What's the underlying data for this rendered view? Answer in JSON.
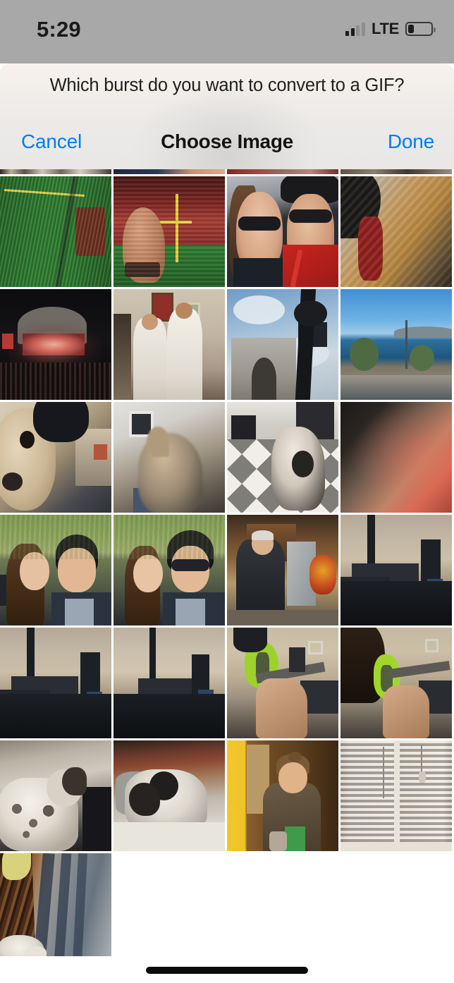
{
  "status_bar": {
    "time": "5:29",
    "carrier_network": "LTE",
    "signal_bars_filled": 2,
    "signal_bars_total": 4,
    "battery_percent": 26,
    "background_color": "#a8a8a8"
  },
  "dialog": {
    "prompt": "Which burst do you want to convert to a GIF?",
    "cancel_label": "Cancel",
    "title": "Choose Image",
    "done_label": "Done",
    "accent_color": "#007aff",
    "title_color": "#141414"
  },
  "photo_grid": {
    "columns": 4,
    "cell_size": 158,
    "gap": 3,
    "rows": [
      {
        "partial": true,
        "cells": [
          {
            "name": "thumb-sliver-text-banner",
            "art": "a-sl1",
            "alt": "cropped bottom edge of banner photo"
          },
          {
            "name": "thumb-sliver-dark-blue",
            "art": "a-sl2",
            "alt": "cropped bottom edge of dark photo"
          },
          {
            "name": "thumb-sliver-red-crowd",
            "art": "a-sl3",
            "alt": "cropped bottom edge of red crowd photo"
          },
          {
            "name": "thumb-sliver-tan",
            "art": "a-sl4",
            "alt": "cropped bottom edge of tan photo"
          }
        ]
      },
      {
        "partial": false,
        "cells": [
          {
            "name": "thumb-stadium-aerial",
            "art": "a-stad1",
            "alt": "aerial view of packed football stadium with green field"
          },
          {
            "name": "thumb-stadium-hand-field",
            "art": "a-stad2",
            "alt": "hand raised in front of football field goalpost"
          },
          {
            "name": "thumb-couple-selfie-game",
            "art": "a-couple-red",
            "alt": "couple selfie in sunglasses at game wearing red"
          },
          {
            "name": "thumb-golden-dog-car",
            "art": "a-dog-gold",
            "alt": "golden fluffy dog curled up"
          }
        ]
      },
      {
        "partial": false,
        "cells": [
          {
            "name": "thumb-concert-amphitheater",
            "art": "a-bowl",
            "alt": "lit concert stage at night amphitheater"
          },
          {
            "name": "thumb-two-men-white-shirts",
            "art": "a-twomen",
            "alt": "two men in white shirts standing indoors"
          },
          {
            "name": "thumb-arc-de-triomphe",
            "art": "a-arc",
            "alt": "Arc de Triomphe under cloudy blue sky with pole"
          },
          {
            "name": "thumb-seaside-road",
            "art": "a-sea",
            "alt": "coastal road with blue sea and trees"
          }
        ]
      },
      {
        "partial": false,
        "cells": [
          {
            "name": "thumb-dog-closeup-cap",
            "art": "a-dogcap",
            "alt": "close-up of tan dog face near a black cap"
          },
          {
            "name": "thumb-fluffy-dog-blur",
            "art": "a-fluffy",
            "alt": "blurry fluffy dog indoors"
          },
          {
            "name": "thumb-dog-on-quilt",
            "art": "a-quilt",
            "alt": "dog on grey and white checkered quilt"
          },
          {
            "name": "thumb-blurred-warm-motion",
            "art": "a-warmblur-w",
            "alt": "heavily blurred warm-toned motion shot"
          }
        ]
      },
      {
        "partial": false,
        "cells": [
          {
            "name": "thumb-couple-kiss-grass",
            "art": "a-kiss",
            "alt": "woman kissing man on cheek on grass"
          },
          {
            "name": "thumb-couple-glasses-grass",
            "art": "a-couple2",
            "alt": "couple posing together on grass, man in glasses"
          },
          {
            "name": "thumb-kitchen-older-man",
            "art": "a-kitchen",
            "alt": "older man in kitchen near fridge and fall flowers"
          },
          {
            "name": "thumb-shooting-range-bench-1",
            "art": "a-range1",
            "alt": "outdoor shooting range bench in shade"
          }
        ]
      },
      {
        "partial": false,
        "cells": [
          {
            "name": "thumb-shooting-range-bench-2",
            "art": "a-range1",
            "alt": "shooting range bench with person aiming"
          },
          {
            "name": "thumb-shooting-range-bench-3",
            "art": "a-range2",
            "alt": "shooting range bench second frame"
          },
          {
            "name": "thumb-shooter-green-earmuffs-1",
            "art": "a-shooter1",
            "alt": "shooter in green earmuffs aiming rifle downrange"
          },
          {
            "name": "thumb-shooter-green-earmuffs-2",
            "art": "a-shooter2",
            "alt": "shooter with dark hair in green earmuffs aiming rifle"
          }
        ]
      },
      {
        "partial": false,
        "cells": [
          {
            "name": "thumb-spotted-dog-room",
            "art": "a-dogroom",
            "alt": "white spotted dog standing in a room"
          },
          {
            "name": "thumb-spotted-dog-rug",
            "art": "a-dogrug",
            "alt": "white and black spotted dog lying on a rug"
          },
          {
            "name": "thumb-woman-yellow-wall",
            "art": "a-woman",
            "alt": "woman seated at table by a yellow wall holding a cup"
          },
          {
            "name": "thumb-window-blinds",
            "art": "a-blinds",
            "alt": "white window blinds with pull cords"
          }
        ]
      },
      {
        "partial": false,
        "cells": [
          {
            "name": "thumb-sidewalk-shadows-dog",
            "art": "a-sidewalk",
            "alt": "sidewalk with long shadows, white dog on a leash"
          }
        ]
      }
    ]
  },
  "home_indicator": {
    "visible": true
  }
}
